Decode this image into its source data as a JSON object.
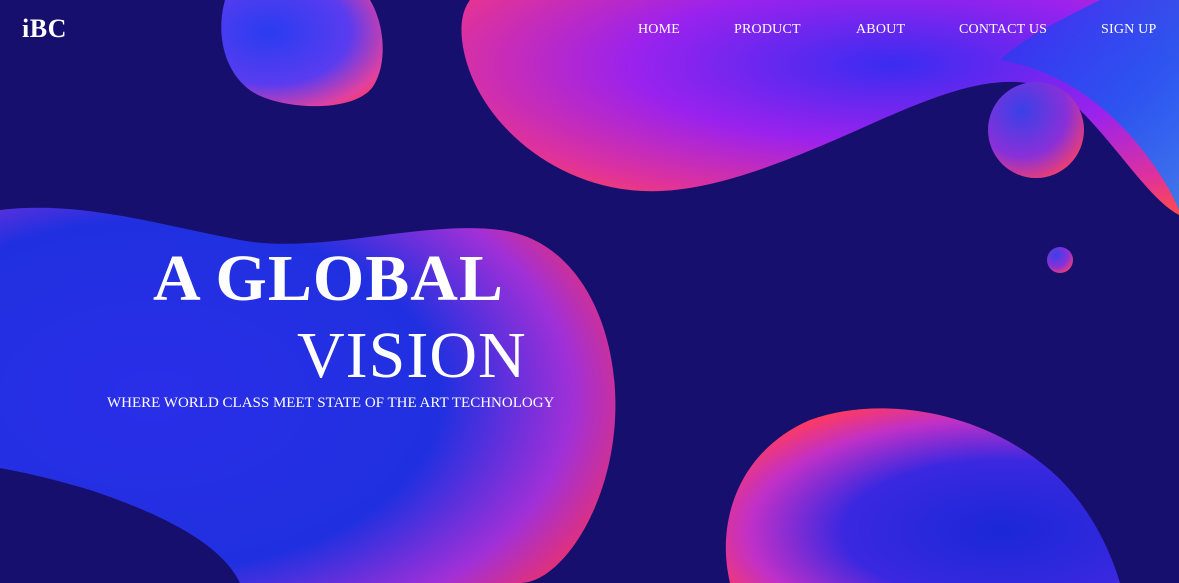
{
  "brand": {
    "logo": "iBC"
  },
  "nav": {
    "items": [
      {
        "label": "HOME"
      },
      {
        "label": "PRODUCT"
      },
      {
        "label": "ABOUT"
      },
      {
        "label": "CONTACT US"
      },
      {
        "label": "SIGN UP"
      }
    ]
  },
  "hero": {
    "title_line1": "A GLOBAL",
    "title_line2": "VISION",
    "subtitle": "WHERE WORLD CLASS MEET STATE OF THE ART TECHNOLOGY"
  },
  "colors": {
    "background": "#160f6e",
    "blob_blue": "#2233e0",
    "blob_violet": "#9a1fe8",
    "blob_pink": "#ff3d7a",
    "text": "#ffffff"
  }
}
